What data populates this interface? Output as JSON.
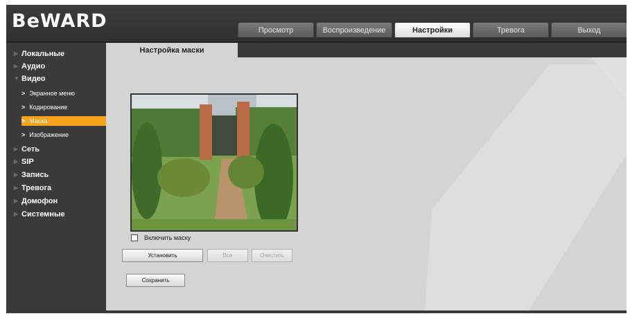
{
  "brand": {
    "logo_text": "BeWARD"
  },
  "top_tabs": [
    {
      "label": "Просмотр",
      "active": false
    },
    {
      "label": "Воспроизведение",
      "active": false
    },
    {
      "label": "Настройки",
      "active": true
    },
    {
      "label": "Тревога",
      "active": false
    },
    {
      "label": "Выход",
      "active": false
    }
  ],
  "sidebar": {
    "items": [
      {
        "label": "Локальные",
        "icon": "triangle-right-icon"
      },
      {
        "label": "Аудио",
        "icon": "triangle-right-icon"
      },
      {
        "label": "Видео",
        "icon": "triangle-down-icon"
      },
      {
        "label": "Сеть",
        "icon": "triangle-right-icon"
      },
      {
        "label": "SIP",
        "icon": "triangle-right-icon"
      },
      {
        "label": "Запись",
        "icon": "triangle-right-icon"
      },
      {
        "label": "Тревога",
        "icon": "triangle-right-icon"
      },
      {
        "label": "Домофон",
        "icon": "triangle-right-icon"
      },
      {
        "label": "Системные",
        "icon": "triangle-right-icon"
      }
    ],
    "video_subitems": [
      {
        "label": "Экранное меню",
        "active": false
      },
      {
        "label": "Кодирование",
        "active": false
      },
      {
        "label": "Маска",
        "active": true
      },
      {
        "label": "Изображение",
        "active": false
      }
    ]
  },
  "section": {
    "title": "Настройка маски"
  },
  "mask": {
    "enable_label": "Включить маску",
    "enable_checked": false,
    "set_button": "Установить",
    "all_button": "Все",
    "clear_button": "Очистить",
    "save_button": "Сохранить"
  },
  "colors": {
    "accent": "#f7a21b",
    "panel": "#d4d4d4",
    "chrome": "#3a3a3a"
  }
}
